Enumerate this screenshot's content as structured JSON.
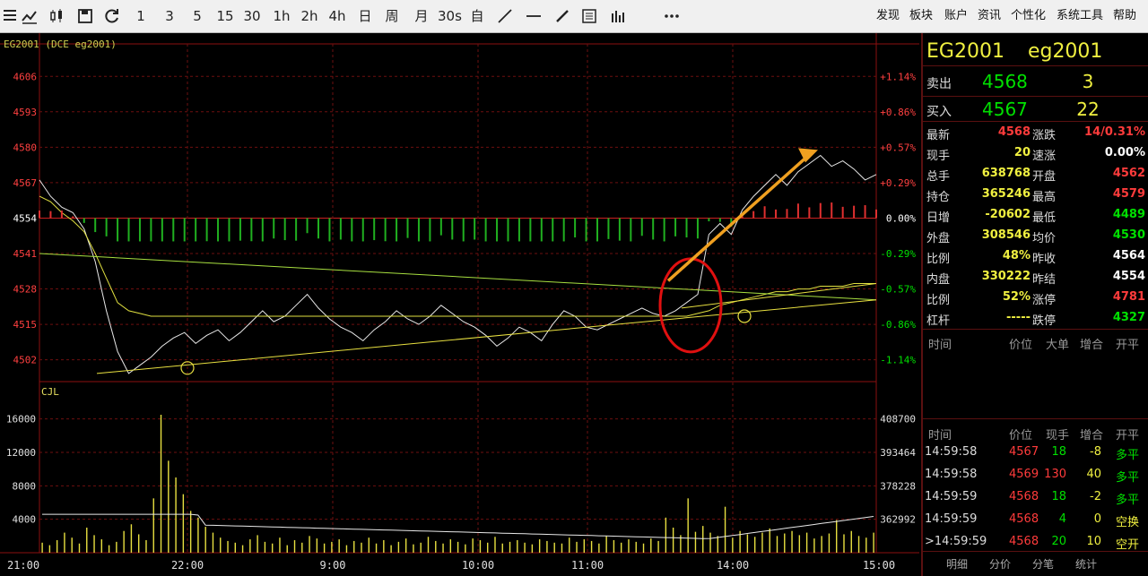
{
  "toolbar": {
    "periods": [
      "1",
      "3",
      "5",
      "15",
      "30",
      "1h",
      "2h",
      "4h",
      "日",
      "周",
      "月",
      "30s",
      "自"
    ],
    "menus": [
      "发现",
      "板块",
      "账户",
      "资讯",
      "个性化",
      "系统工具",
      "帮助"
    ]
  },
  "chart": {
    "symbol_header": "EG2001  (DCE eg2001)",
    "volume_label": "CJL"
  },
  "chart_data": [
    {
      "type": "line",
      "x_labels": [
        "21:00",
        "22:00",
        "9:00",
        "10:00",
        "11:00",
        "14:00",
        "15:00"
      ],
      "y_ticks": [
        4606,
        4593,
        4580,
        4567,
        4554,
        4541,
        4528,
        4515,
        4502
      ],
      "y_right_ticks": [
        "+1.14%",
        "+0.86%",
        "+0.57%",
        "+0.29%",
        "0.00%",
        "-0.29%",
        "-0.57%",
        "-0.86%",
        "-1.14%"
      ],
      "ylim": [
        4494,
        4612
      ],
      "prev_settle": 4554,
      "series": [
        {
          "values": [
            4568,
            4562,
            4558,
            4556,
            4550,
            4538,
            4520,
            4505,
            4497,
            4500,
            4503,
            4507,
            4510,
            4512,
            4508,
            4511,
            4513,
            4509,
            4512,
            4516,
            4520,
            4516,
            4518,
            4522,
            4526,
            4521,
            4517,
            4514,
            4512,
            4509,
            4513,
            4516,
            4520,
            4517,
            4515,
            4518,
            4522,
            4519,
            4516,
            4514,
            4511,
            4507,
            4510,
            4514,
            4512,
            4509,
            4515,
            4520,
            4518,
            4514,
            4513,
            4515,
            4517,
            4519,
            4521,
            4519,
            4518,
            4520,
            4523,
            4526,
            4548,
            4552,
            4548,
            4557,
            4562,
            4566,
            4570,
            4566,
            4571,
            4574,
            4577,
            4573,
            4575,
            4572,
            4568,
            4570
          ]
        },
        {
          "values": [
            4562,
            4560,
            4556,
            4553,
            4549,
            4541,
            4532,
            4523,
            4520,
            4519,
            4518,
            4518,
            4518,
            4518,
            4518,
            4518,
            4518,
            4518,
            4518,
            4518,
            4518,
            4518,
            4518,
            4518,
            4518,
            4518,
            4518,
            4518,
            4518,
            4518,
            4518,
            4518,
            4518,
            4518,
            4518,
            4518,
            4518,
            4518,
            4518,
            4518,
            4518,
            4518,
            4518,
            4518,
            4518,
            4518,
            4518,
            4518,
            4518,
            4518,
            4518,
            4518,
            4518,
            4518,
            4518,
            4518,
            4518,
            4518,
            4518,
            4519,
            4520,
            4522,
            4523,
            4524,
            4525,
            4526,
            4527,
            4527,
            4528,
            4528,
            4529,
            4529,
            4529,
            4530,
            4530,
            4530
          ]
        }
      ],
      "annotations": [
        "red-circle",
        "orange-arrow",
        "yellow-circle",
        "yellow-circle"
      ]
    },
    {
      "type": "bar",
      "y_ticks": [
        16000,
        12000,
        8000,
        4000
      ],
      "y_right_ticks": [
        "408700",
        "393464",
        "378228",
        "362992"
      ],
      "ylim": [
        0,
        19500
      ],
      "values": [
        1200,
        900,
        1500,
        2400,
        1800,
        1100,
        3000,
        2100,
        1600,
        900,
        1300,
        2600,
        3400,
        2200,
        1500,
        6500,
        16500,
        11000,
        9000,
        7000,
        5000,
        4200,
        3100,
        2400,
        1800,
        1400,
        1200,
        900,
        1600,
        2100,
        1300,
        1100,
        1800,
        900,
        1500,
        1200,
        2000,
        1700,
        1100,
        1300,
        1600,
        900,
        1400,
        1200,
        1800,
        1100,
        1500,
        900,
        1300,
        1700,
        1000,
        1200,
        1900,
        1400,
        1100,
        1600,
        1300,
        1000,
        1700,
        1500,
        1200,
        1900,
        1100,
        1300,
        1500,
        1200,
        1000,
        1600,
        1400,
        1200,
        1100,
        1800,
        1300,
        1600,
        1400,
        1100,
        2000,
        1500,
        1200,
        1600,
        1300,
        1100,
        1700,
        1400,
        4200,
        3000,
        2100,
        6500,
        2500,
        3200,
        2400,
        2000,
        5500,
        1800,
        2600,
        2200,
        1900,
        2400,
        2900,
        2000,
        2300,
        2600,
        2100,
        2400,
        1700,
        2000,
        2300,
        3900,
        2200,
        2600,
        2000,
        1800,
        2400
      ]
    }
  ],
  "panel": {
    "symbol": "EG2001",
    "code": "eg2001",
    "sell_label": "卖出",
    "sell_price": "4568",
    "sell_vol": "3",
    "buy_label": "买入",
    "buy_price": "4567",
    "buy_vol": "22",
    "quotes": [
      {
        "l1": "最新",
        "v1": "4568",
        "c1": "red",
        "l2": "涨跌",
        "v2": "14/0.31%",
        "c2": "red"
      },
      {
        "l1": "现手",
        "v1": "20",
        "c1": "yellow",
        "l2": "速涨",
        "v2": "0.00%",
        "c2": "white"
      },
      {
        "l1": "总手",
        "v1": "638768",
        "c1": "yellow",
        "l2": "开盘",
        "v2": "4562",
        "c2": "red"
      },
      {
        "l1": "持仓",
        "v1": "365246",
        "c1": "yellow",
        "l2": "最高",
        "v2": "4579",
        "c2": "red"
      },
      {
        "l1": "日增",
        "v1": "-20602",
        "c1": "yellow",
        "l2": "最低",
        "v2": "4489",
        "c2": "green"
      },
      {
        "l1": "外盘",
        "v1": "308546",
        "c1": "yellow",
        "l2": "均价",
        "v2": "4530",
        "c2": "green"
      },
      {
        "l1": "比例",
        "v1": "48%",
        "c1": "yellow",
        "l2": "昨收",
        "v2": "4564",
        "c2": "white"
      },
      {
        "l1": "内盘",
        "v1": "330222",
        "c1": "yellow",
        "l2": "昨结",
        "v2": "4554",
        "c2": "white"
      },
      {
        "l1": "比例",
        "v1": "52%",
        "c1": "yellow",
        "l2": "涨停",
        "v2": "4781",
        "c2": "red"
      },
      {
        "l1": "杠杆",
        "v1": "-----",
        "c1": "yellow",
        "l2": "跌停",
        "v2": "4327",
        "c2": "green"
      }
    ],
    "big_head": [
      "时间",
      "价位",
      "大单",
      "增合",
      "开平"
    ],
    "tick_head": [
      "时间",
      "价位",
      "现手",
      "增合",
      "开平"
    ],
    "ticks": [
      {
        "time": "14:59:58",
        "price": "4567",
        "pc": "red",
        "vol": "18",
        "vc": "green",
        "oi": "-8",
        "oc": "yellow",
        "type": "多平",
        "tc": "green"
      },
      {
        "time": "14:59:58",
        "price": "4569",
        "pc": "red",
        "vol": "130",
        "vc": "red",
        "oi": "40",
        "oc": "yellow",
        "type": "多平",
        "tc": "green"
      },
      {
        "time": "14:59:59",
        "price": "4568",
        "pc": "red",
        "vol": "18",
        "vc": "green",
        "oi": "-2",
        "oc": "yellow",
        "type": "多平",
        "tc": "green"
      },
      {
        "time": "14:59:59",
        "price": "4568",
        "pc": "red",
        "vol": "4",
        "vc": "green",
        "oi": "0",
        "oc": "yellow",
        "type": "空换",
        "tc": "yellow"
      },
      {
        "time": ">14:59:59",
        "price": "4568",
        "pc": "red",
        "vol": "20",
        "vc": "green",
        "oi": "10",
        "oc": "yellow",
        "type": "空开",
        "tc": "yellow"
      }
    ],
    "tabs": [
      "明细",
      "分价",
      "分笔",
      "统计"
    ]
  }
}
